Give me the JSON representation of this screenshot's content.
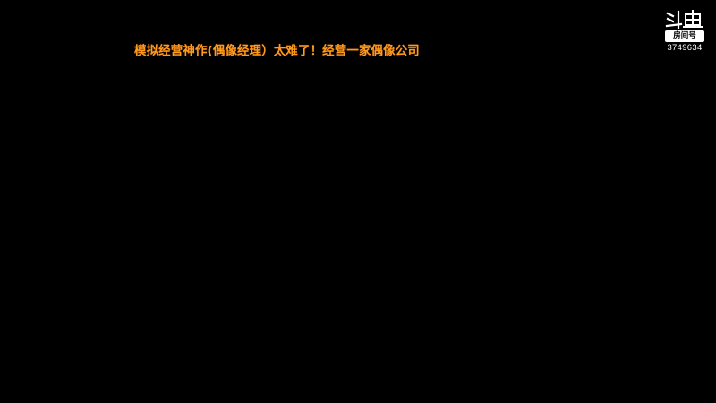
{
  "stream": {
    "title": "模拟经营神作(偶像经理）太难了！经营一家偶像公司",
    "title_color": "#ff9a1f",
    "background_color": "#000000"
  },
  "watermark": {
    "logo_name": "douyu-logo-icon",
    "room_label": "房间号",
    "room_id": "3749634"
  }
}
